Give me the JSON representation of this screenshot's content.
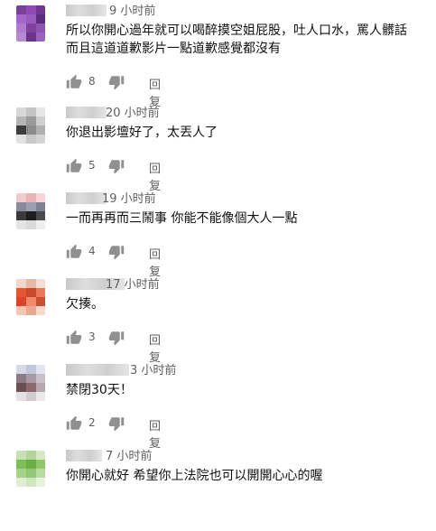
{
  "comments": [
    {
      "time": "9 小时前",
      "text": "所以你開心過年就可以喝醉摸空姐屁股，吐人口水，罵人髒話\n而且這道道歉影片一點道歉感覺都沒有",
      "likes": "8",
      "reply_label": "回复",
      "avatar_colors": [
        "#7b3f9e",
        "#8e4cb3",
        "#6f358f",
        "#a467c9",
        "#9a5bbf",
        "#5e2c7c",
        "#b07ad0",
        "#7d42a0",
        "#8d54b0",
        "#b38bd0",
        "#6a3489",
        "#9c62c0"
      ]
    },
    {
      "time": "20 小时前",
      "text": "你退出影壇好了，太丟人了",
      "likes": "5",
      "reply_label": "回复",
      "avatar_colors": [
        "#d8d8d8",
        "#c4c4c4",
        "#e6e6e6",
        "#b5b5b5",
        "#9a9a9a",
        "#cfcfcf",
        "#3d3d3d",
        "#8c8c8c",
        "#b0b0b0",
        "#e2e2e2",
        "#c8c8c8",
        "#d4d4d4"
      ]
    },
    {
      "time": "19 小时前",
      "text": "一而再再而三鬧事 你能不能像個大人一點",
      "likes": "4",
      "reply_label": "回复",
      "avatar_colors": [
        "#f2c9cc",
        "#e8b4b8",
        "#f5d5d7",
        "#8a8a9a",
        "#9aa0b0",
        "#7c8090",
        "#3a3a3a",
        "#1e1e1e",
        "#4a4a4a",
        "#e4e4e4",
        "#dadada",
        "#eeeeee"
      ]
    },
    {
      "time": "17 小时前",
      "text": "欠揍。",
      "likes": "3",
      "reply_label": "回复",
      "avatar_colors": [
        "#f0d6cc",
        "#e6b9a6",
        "#f3dfd6",
        "#e2572f",
        "#c94a2a",
        "#e87a5a",
        "#d9442a",
        "#f08a6a",
        "#c85030",
        "#f3c5b3",
        "#e9a892",
        "#f6d8cc"
      ]
    },
    {
      "time": "3 小时前",
      "text": "禁閉30天！",
      "likes": "2",
      "reply_label": "回复",
      "avatar_colors": [
        "#d6dae8",
        "#c2c8dc",
        "#e2e6f0",
        "#8a7c86",
        "#a89aa4",
        "#c8c0c8",
        "#6b4f52",
        "#8a6a6d",
        "#b8a8ae",
        "#e4e0e4",
        "#d2cbd0",
        "#ece8ec"
      ]
    },
    {
      "time": "7 小时前",
      "text": "你開心就好 希望你上法院也可以開開心心的喔",
      "likes": "",
      "reply_label": "",
      "avatar_colors": [
        "#c9e0b6",
        "#b5d69a",
        "#d6e8c8",
        "#7fbf5a",
        "#6aae44",
        "#8cc96a",
        "#a4d38a",
        "#92c777",
        "#b8dca2",
        "#e0efd4",
        "#cfe6c0",
        "#e8f3de"
      ]
    }
  ]
}
